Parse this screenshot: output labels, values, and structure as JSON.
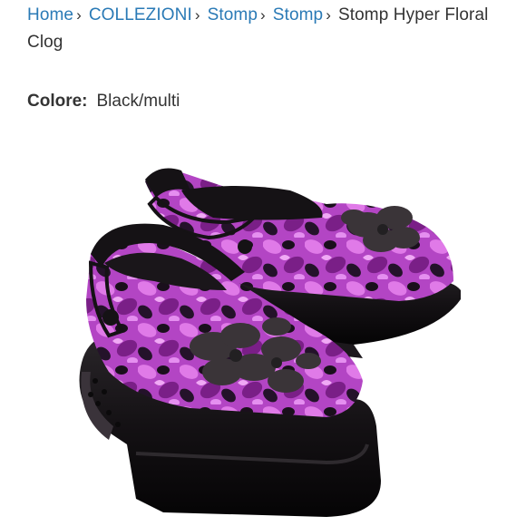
{
  "breadcrumb": {
    "items": [
      {
        "label": "Home",
        "separator": "›"
      },
      {
        "label": "COLLEZIONI",
        "separator": "›"
      },
      {
        "label": "Stomp",
        "separator": "›"
      },
      {
        "label": "Stomp",
        "separator": "›"
      }
    ],
    "current": "Stomp Hyper Floral Clog"
  },
  "product": {
    "color_label": "Colore:",
    "color_value": "Black/multi",
    "image": {
      "subject": "clog-pair",
      "colors": {
        "pattern_light": "#c24fd0",
        "pattern_dark": "#7a1f87",
        "black": "#151215",
        "charm": "#3a3438"
      }
    }
  },
  "theme": {
    "link_color": "#2a7ab6",
    "text_color": "#333333",
    "background": "#ffffff"
  }
}
